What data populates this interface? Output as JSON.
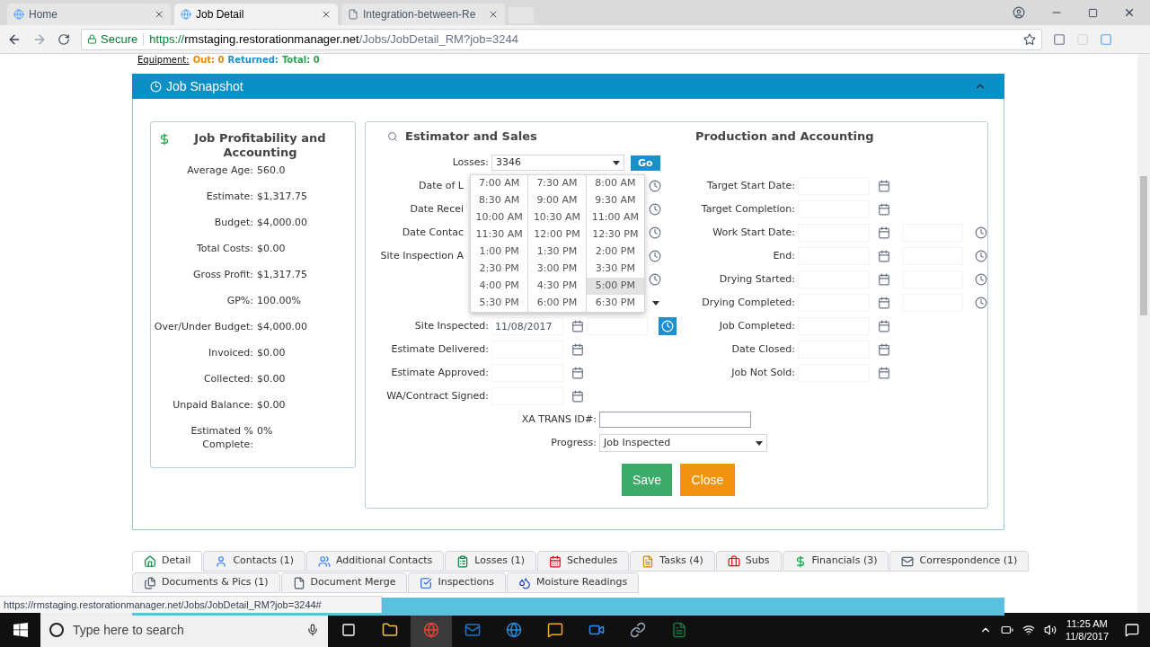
{
  "browser": {
    "tabs": [
      {
        "title": "Home",
        "selected": false
      },
      {
        "title": "Job Detail",
        "selected": true
      },
      {
        "title": "Integration-between-Re",
        "selected": false
      }
    ],
    "security": "Secure",
    "url": {
      "scheme": "https://",
      "host": "rmstaging.restorationmanager.net",
      "path": "/Jobs/JobDetail_RM?job=3244"
    }
  },
  "equipment": {
    "label": "Equipment:",
    "out": "Out: 0",
    "returned": "Returned:",
    "total": "Total: 0"
  },
  "snapshot": {
    "title": "Job Snapshot",
    "expanded": true
  },
  "profitability": {
    "title": "Job Profitability and Accounting",
    "rows": [
      {
        "label": "Average Age:",
        "value": "560.0"
      },
      {
        "label": "Estimate:",
        "value": "$1,317.75"
      },
      {
        "label": "Budget:",
        "value": "$4,000.00"
      },
      {
        "label": "Total Costs:",
        "value": "$0.00"
      },
      {
        "label": "Gross Profit:",
        "value": "$1,317.75"
      },
      {
        "label": "GP%:",
        "value": "100.00%"
      },
      {
        "label": "Over/Under Budget:",
        "value": "$4,000.00"
      },
      {
        "label": "Invoiced:",
        "value": "$0.00"
      },
      {
        "label": "Collected:",
        "value": "$0.00"
      },
      {
        "label": "Unpaid Balance:",
        "value": "$0.00"
      },
      {
        "label": "Estimated % Complete:",
        "value": "0%"
      }
    ]
  },
  "estimator": {
    "title": "Estimator and Sales",
    "rows": [
      {
        "kind": "select",
        "label": "Losses:",
        "value": "3346",
        "button": "Go"
      },
      {
        "kind": "covered",
        "label": "Date of L",
        "clock": true
      },
      {
        "kind": "covered",
        "label": "Date Recei",
        "clock": true
      },
      {
        "kind": "covered",
        "label": "Date Contac",
        "clock": true
      },
      {
        "kind": "covered",
        "label": "Site Inspection A",
        "clock": true
      },
      {
        "kind": "covered",
        "clock": true
      },
      {
        "kind": "covered",
        "dropdown": true
      },
      {
        "kind": "datetime",
        "label": "Site Inspected:",
        "date": "11/08/2017",
        "clock_highlight": true
      },
      {
        "kind": "date",
        "label": "Estimate Delivered:"
      },
      {
        "kind": "date",
        "label": "Estimate Approved:"
      },
      {
        "kind": "date",
        "label": "WA/Contract Signed:"
      }
    ]
  },
  "production": {
    "title": "Production and Accounting",
    "rows": [
      {
        "kind": "date",
        "label": "Target Start Date:"
      },
      {
        "kind": "date",
        "label": "Target Completion:"
      },
      {
        "kind": "datetime",
        "label": "Work Start Date:",
        "clock_highlight": false
      },
      {
        "kind": "datetime",
        "label": "End:",
        "clock_highlight": false
      },
      {
        "kind": "datetime",
        "label": "Drying Started:",
        "clock_highlight": false
      },
      {
        "kind": "datetime",
        "label": "Drying Completed:",
        "clock_highlight": false
      },
      {
        "kind": "date",
        "label": "Job Completed:"
      },
      {
        "kind": "date",
        "label": "Date Closed:"
      },
      {
        "kind": "date",
        "label": "Job Not Sold:"
      }
    ]
  },
  "xa_trans": {
    "label": "XA TRANS ID#:"
  },
  "progress": {
    "label": "Progress:",
    "value": "Job Inspected"
  },
  "buttons": [
    {
      "label": "Save",
      "kind": "save"
    },
    {
      "label": "Close",
      "kind": "close"
    }
  ],
  "time_picker": {
    "times": [
      {
        "label": "7:00 AM",
        "selected": false
      },
      {
        "label": "7:30 AM",
        "selected": false
      },
      {
        "label": "8:00 AM",
        "selected": false
      },
      {
        "label": "8:30 AM",
        "selected": false
      },
      {
        "label": "9:00 AM",
        "selected": false
      },
      {
        "label": "9:30 AM",
        "selected": false
      },
      {
        "label": "10:00 AM",
        "selected": false
      },
      {
        "label": "10:30 AM",
        "selected": false
      },
      {
        "label": "11:00 AM",
        "selected": false
      },
      {
        "label": "11:30 AM",
        "selected": false
      },
      {
        "label": "12:00 PM",
        "selected": false
      },
      {
        "label": "12:30 PM",
        "selected": false
      },
      {
        "label": "1:00 PM",
        "selected": false
      },
      {
        "label": "1:30 PM",
        "selected": false
      },
      {
        "label": "2:00 PM",
        "selected": false
      },
      {
        "label": "2:30 PM",
        "selected": false
      },
      {
        "label": "3:00 PM",
        "selected": false
      },
      {
        "label": "3:30 PM",
        "selected": false
      },
      {
        "label": "4:00 PM",
        "selected": false
      },
      {
        "label": "4:30 PM",
        "selected": false
      },
      {
        "label": "5:00 PM",
        "selected": true
      },
      {
        "label": "5:30 PM",
        "selected": false
      },
      {
        "label": "6:00 PM",
        "selected": false
      },
      {
        "label": "6:30 PM",
        "selected": false
      }
    ]
  },
  "section_tabs": [
    [
      {
        "label": "Detail",
        "selected": true
      },
      {
        "label": "Contacts (1)",
        "selected": false
      },
      {
        "label": "Additional Contacts",
        "selected": false
      },
      {
        "label": "Losses (1)",
        "selected": false
      },
      {
        "label": "Schedules",
        "selected": false
      },
      {
        "label": "Tasks (4)",
        "selected": false
      },
      {
        "label": "Subs",
        "selected": false
      },
      {
        "label": "Financials (3)",
        "selected": false
      },
      {
        "label": "Correspondence (1)",
        "selected": false
      }
    ],
    [
      {
        "label": "Documents & Pics (1)",
        "selected": false
      },
      {
        "label": "Document Merge",
        "selected": false
      },
      {
        "label": "Inspections",
        "selected": false
      },
      {
        "label": "Moisture Readings",
        "selected": false
      }
    ]
  ],
  "status_url": "https://rmstaging.restorationmanager.net/Jobs/JobDetail_RM?job=3244#",
  "taskbar": {
    "search_placeholder": "Type here to search",
    "time": "11:25 AM",
    "date": "11/8/2017"
  }
}
